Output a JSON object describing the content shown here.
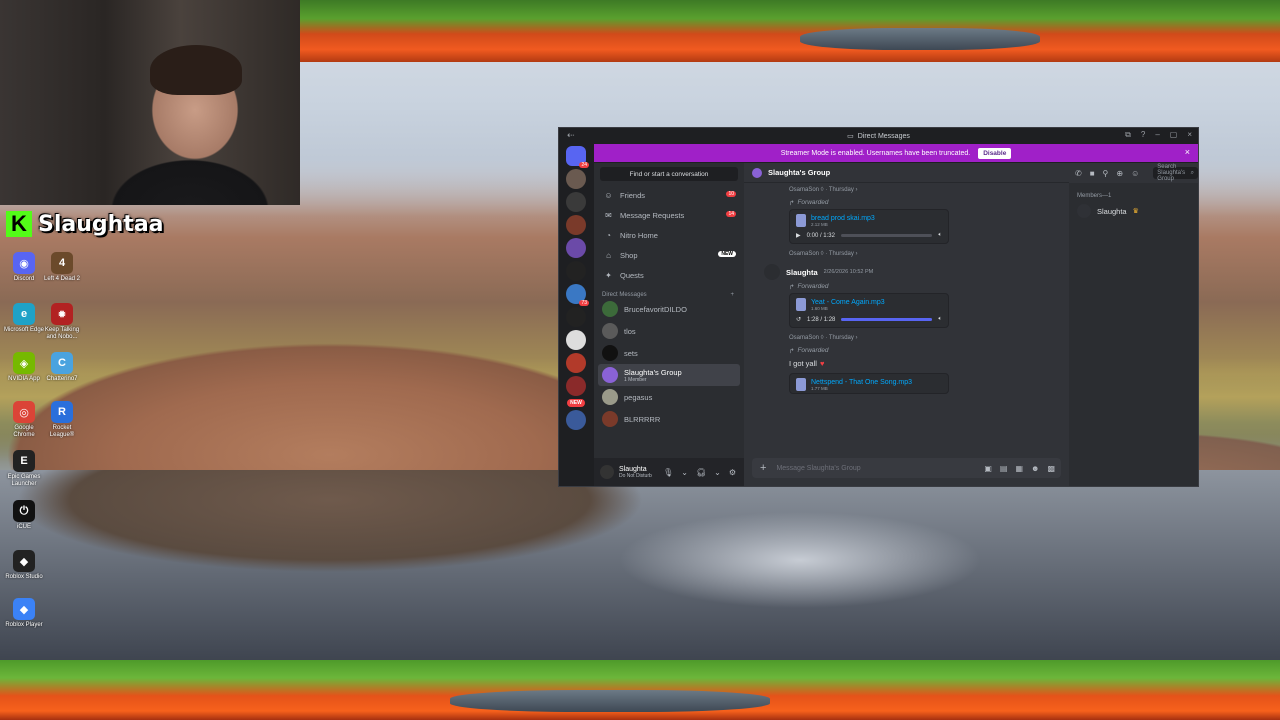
{
  "stream": {
    "streamer_name": "Slaughtaa"
  },
  "desktop_icons": [
    {
      "label": "Discord",
      "color": "#5865f2",
      "glyph": "◉"
    },
    {
      "label": "Left 4 Dead 2",
      "color": "#6b4a2b",
      "glyph": "4"
    },
    {
      "label": "Microsoft Edge",
      "color": "#1fa2c7",
      "glyph": "e"
    },
    {
      "label": "Keep Talking and Nobo...",
      "color": "#b22222",
      "glyph": "✹"
    },
    {
      "label": "NVIDIA App",
      "color": "#76b900",
      "glyph": "◈"
    },
    {
      "label": "Chatterino7",
      "color": "#4aa3df",
      "glyph": "C"
    },
    {
      "label": "Google Chrome",
      "color": "#db4437",
      "glyph": "◎"
    },
    {
      "label": "Rocket League®",
      "color": "#2a6fdb",
      "glyph": "R"
    },
    {
      "label": "Epic Games Launcher",
      "color": "#222222",
      "glyph": "E"
    },
    {
      "label": "iCUE",
      "color": "#111111",
      "glyph": "⏻"
    },
    {
      "label": "Roblox Studio",
      "color": "#222222",
      "glyph": "◆"
    },
    {
      "label": "Roblox Player",
      "color": "#3b82f6",
      "glyph": "◆"
    }
  ],
  "discord": {
    "window_title": "Direct Messages",
    "banner": {
      "text": "Streamer Mode is enabled. Usernames have been truncated.",
      "button": "Disable"
    },
    "servers": [
      {
        "color": "#5865f2",
        "badge": "24"
      },
      {
        "color": "#6a5a50",
        "badge": ""
      },
      {
        "color": "#3a3a3a",
        "badge": ""
      },
      {
        "color": "#7a3a2a",
        "badge": ""
      },
      {
        "color": "#6b4aa8",
        "badge": ""
      },
      {
        "color": "#222222",
        "badge": ""
      },
      {
        "color": "#3a78c4",
        "badge": "73"
      },
      {
        "color": "#222222",
        "badge": ""
      },
      {
        "color": "#dddddd",
        "badge": ""
      },
      {
        "color": "#b23a2a",
        "badge": ""
      },
      {
        "color": "#8a2a2a",
        "badge": ""
      },
      {
        "color": "#3a5a9a",
        "badge": ""
      }
    ],
    "new_label": "NEW",
    "search_conversation": "Find or start a conversation",
    "nav": [
      {
        "label": "Friends",
        "icon": "person-icon",
        "pill": "10"
      },
      {
        "label": "Message Requests",
        "icon": "mail-icon",
        "pill": "14"
      },
      {
        "label": "Nitro Home",
        "icon": "nitro-icon",
        "pill": ""
      },
      {
        "label": "Shop",
        "icon": "shop-icon",
        "pill": "NEW"
      },
      {
        "label": "Quests",
        "icon": "quests-icon",
        "pill": ""
      }
    ],
    "dm_header": "Direct Messages",
    "dm_add": "+",
    "dms": [
      {
        "name": "BrucefavoritDILDO",
        "sub": "",
        "color": "#3c6a3a"
      },
      {
        "name": "tlos",
        "sub": "",
        "color": "#5a5a5a"
      },
      {
        "name": "sets",
        "sub": "",
        "color": "#111111"
      },
      {
        "name": "Slaughta's Group",
        "sub": "1 Member",
        "color": "#8a62d6"
      },
      {
        "name": "pegasus",
        "sub": "",
        "color": "#9a9a8a"
      },
      {
        "name": "BLRRRRR",
        "sub": "",
        "color": "#7a3a2a"
      }
    ],
    "user": {
      "name": "Slaughta",
      "status": "Do Not Disturb"
    },
    "chat": {
      "title": "Slaughta's Group",
      "messages": [
        {
          "ref": "OsamaSon ◊ · Thursday ›",
          "forwarded": "Forwarded",
          "file": "bread prod skai.mp3",
          "size": "2.12 MB",
          "time": "0:00 / 1:32",
          "progress": 0
        },
        {
          "ref": "OsamaSon ◊ · Thursday ›"
        },
        {
          "author": "Slaughta",
          "timestamp": "2/26/2026 10:52 PM",
          "forwarded": "Forwarded",
          "file": "Yeat - Come Again.mp3",
          "size": "1.60 MB",
          "time": "1:28 / 1:28",
          "progress": 100
        },
        {
          "ref": "OsamaSon ◊ · Thursday ›",
          "forwarded": "Forwarded",
          "text": "I got yall",
          "emoji": "♥"
        },
        {
          "file": "Nettspend - That One Song.mp3",
          "size": "1.77 MB"
        }
      ],
      "composer_placeholder": "Message Slaughta's Group"
    },
    "search_group": "Search Slaughta's Group",
    "members_header": "Members—1",
    "member": {
      "name": "Slaughta",
      "crown": "♛"
    }
  }
}
